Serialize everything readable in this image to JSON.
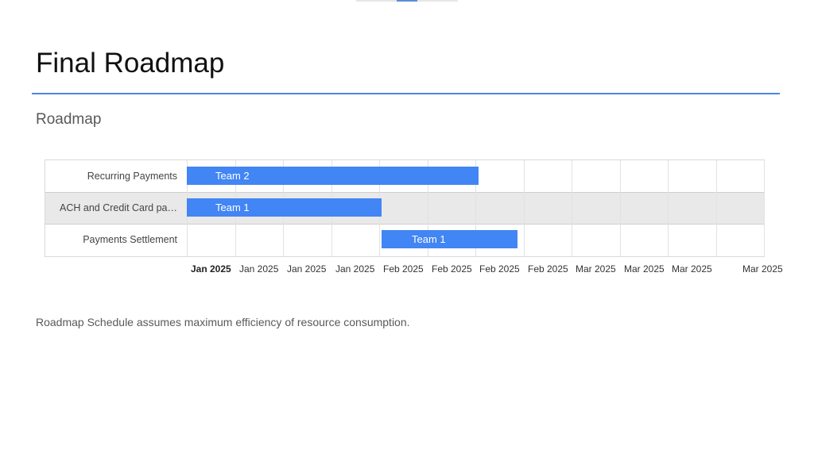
{
  "slide": {
    "title": "Final Roadmap",
    "subtitle": "Roadmap",
    "footnote": "Roadmap Schedule assumes maximum efficiency of resource consumption."
  },
  "colors": {
    "accent_rule": "#4a86e8",
    "bar": "#4285f4",
    "row_shade": "#e9e9e9"
  },
  "chart_data": {
    "type": "gantt",
    "rows": [
      {
        "label": "Recurring Payments",
        "bar_label": "Team 2",
        "start": "2025-01-01",
        "end": "2025-02-15"
      },
      {
        "label": "ACH and Credit Card pa…",
        "bar_label": "Team 1",
        "start": "2025-01-01",
        "end": "2025-01-31"
      },
      {
        "label": "Payments Settlement",
        "bar_label": "Team 1",
        "start": "2025-01-31",
        "end": "2025-02-21"
      }
    ],
    "x_range": [
      "2025-01-01",
      "2025-03-31"
    ],
    "x_ticks": [
      {
        "label": "Jan 2025",
        "bold": true
      },
      {
        "label": "Jan 2025"
      },
      {
        "label": "Jan 2025"
      },
      {
        "label": "Jan 2025"
      },
      {
        "label": "Feb 2025"
      },
      {
        "label": "Feb 2025"
      },
      {
        "label": "Feb 2025"
      },
      {
        "label": "Feb 2025"
      },
      {
        "label": "Mar 2025"
      },
      {
        "label": "Mar 2025"
      },
      {
        "label": "Mar 2025"
      },
      {
        "label": "Mar 2025"
      }
    ],
    "grid": true,
    "alternate_row_shading": true
  }
}
